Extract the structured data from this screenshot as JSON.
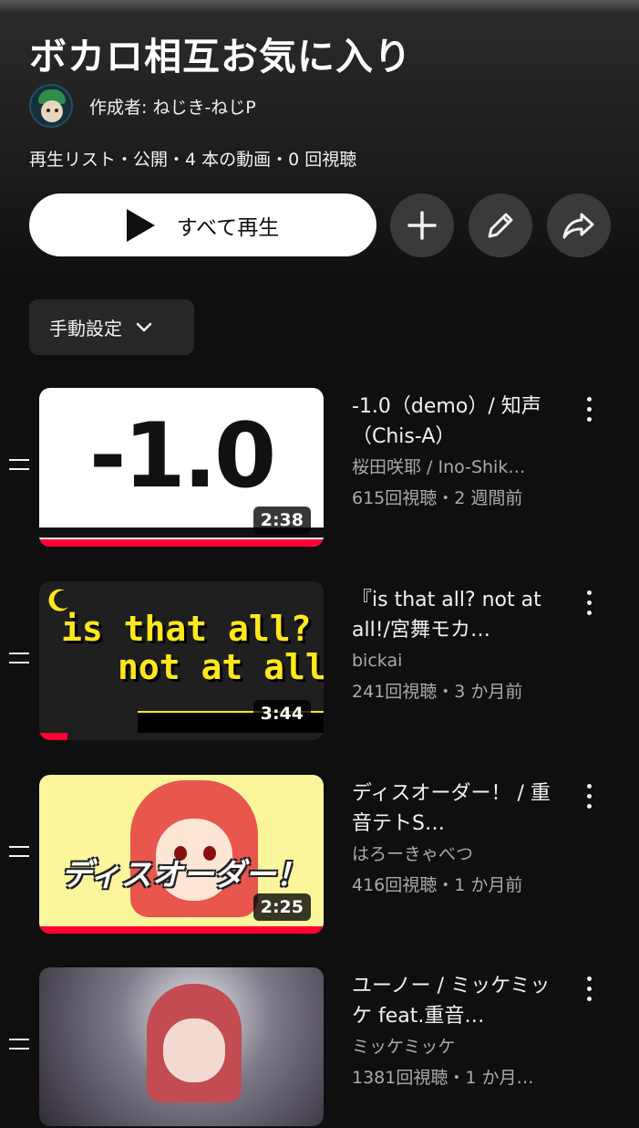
{
  "playlist": {
    "title": "ボカロ相互お気に入り",
    "creator": "作成者: ねじき-ねじP",
    "meta": "再生リスト・公開・4 本の動画・0 回視聴",
    "play_all_label": "すべて再生",
    "sort_label": "手動設定"
  },
  "actions": [
    "add",
    "edit",
    "share"
  ],
  "icons": {
    "play": "play-icon",
    "add": "plus-icon",
    "edit": "pencil-icon",
    "share": "share-icon",
    "sort": "chevron-down-icon",
    "drag": "drag-handle-icon",
    "more": "more-vert-icon"
  },
  "colors": {
    "background": "#0f0f0f",
    "accent": "#ff0033",
    "button_bg": "#3a3a3a",
    "secondary_text": "#aaaaaa"
  },
  "videos": [
    {
      "title": "-1.0（demo）/ 知声（Chis-A）",
      "channel": "桜田咲耶 / Ino-Shik…",
      "stats": "615回視聴・2 週間前",
      "duration": "2:38",
      "thumb_text": "-1.0",
      "watched": 1.0
    },
    {
      "title": "『is that all? not at all!/宮舞モカ…",
      "channel": "bickai",
      "stats": "241回視聴・3 か月前",
      "duration": "3:44",
      "thumb_text": [
        "is that all?",
        "not at all!"
      ],
      "watched": 0.1
    },
    {
      "title": "ディスオーダー！ / 重音テトS…",
      "channel": "はろーきゃべつ",
      "stats": "416回視聴・1 か月前",
      "duration": "2:25",
      "thumb_text": "ディスオーダー！",
      "watched": 1.0
    },
    {
      "title": "ユーノー / ミッケミッケ feat.重音…",
      "channel": "ミッケミッケ",
      "stats": "1381回視聴・1 か月…",
      "duration": "",
      "thumb_text": "",
      "watched": 0.0
    }
  ]
}
